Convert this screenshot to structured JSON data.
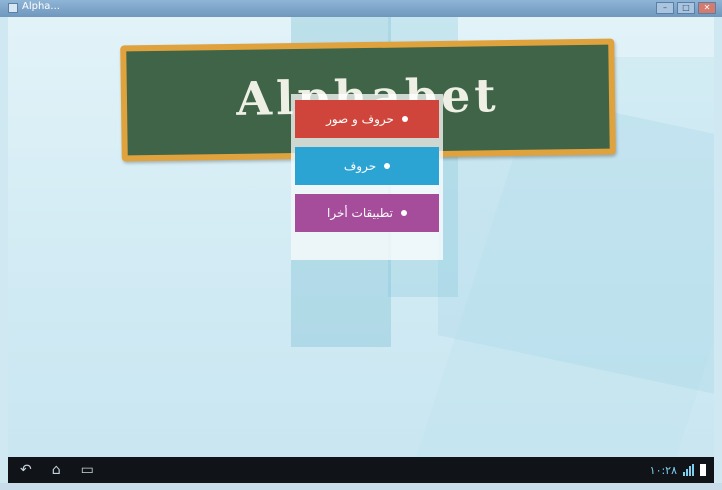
{
  "window": {
    "title": "Alpha..."
  },
  "board": {
    "title": "Alphabet"
  },
  "menu": {
    "items": [
      {
        "label": "حروف و صور",
        "color": "#d0453b"
      },
      {
        "label": "حروف",
        "color": "#2ba3d3"
      },
      {
        "label": "تطبيقات أخرا",
        "color": "#a54d9b"
      }
    ]
  },
  "navbar": {
    "icons": [
      "back-icon",
      "home-icon",
      "recent-apps-icon"
    ],
    "time": "١٠:٢٨",
    "signal_icon": "signal-icon",
    "battery_icon": "battery-icon"
  }
}
